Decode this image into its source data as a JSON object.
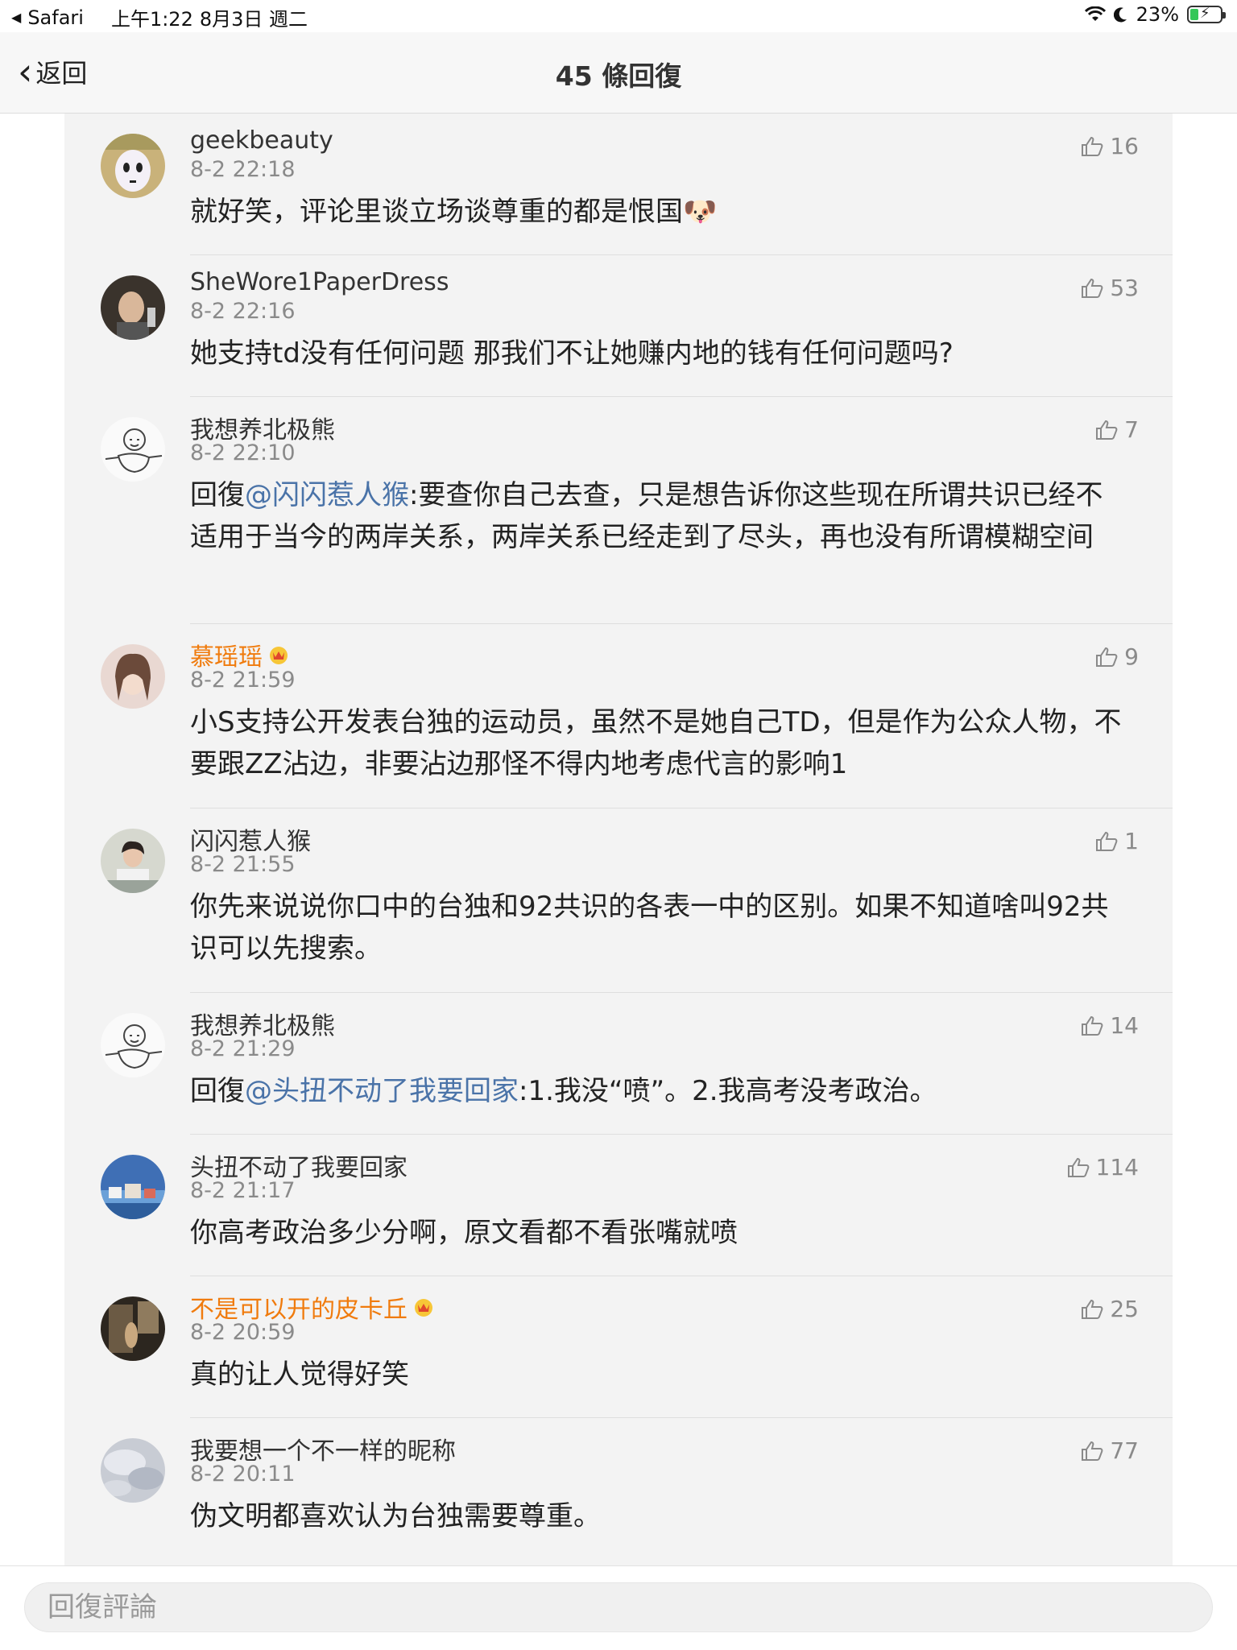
{
  "status_bar": {
    "back_app": "Safari",
    "time": "上午1:22",
    "date": "8月3日 週二",
    "battery": "23%"
  },
  "nav": {
    "back_label": "返回",
    "title": "45 條回復"
  },
  "comments": [
    {
      "name": "geekbeauty",
      "vip": false,
      "time": "8-2 22:18",
      "likes": "16",
      "text": "就好笑，评论里谈立场谈尊重的都是恨国🐶"
    },
    {
      "name": "SheWore1PaperDress",
      "vip": false,
      "time": "8-2 22:16",
      "likes": "53",
      "text": "她支持td没有任何问题 那我们不让她赚内地的钱有任何问题吗?"
    },
    {
      "name": "我想养北极熊",
      "vip": false,
      "time": "8-2 22:10",
      "likes": "7",
      "reply_prefix": "回復",
      "mention": "@闪闪惹人猴",
      "text": ":要查你自己去查，只是想告诉你这些现在所谓共识已经不适用于当今的两岸关系，两岸关系已经走到了尽头，再也没有所谓模糊空间"
    },
    {
      "name": "慕瑶瑶",
      "vip": true,
      "time": "8-2 21:59",
      "likes": "9",
      "text": "小S支持公开发表台独的运动员，虽然不是她自己TD，但是作为公众人物，不要跟ZZ沾边，非要沾边那怪不得内地考虑代言的影响1"
    },
    {
      "name": "闪闪惹人猴",
      "vip": false,
      "time": "8-2 21:55",
      "likes": "1",
      "text": "你先来说说你口中的台独和92共识的各表一中的区别。如果不知道啥叫92共识可以先搜索。"
    },
    {
      "name": "我想养北极熊",
      "vip": false,
      "time": "8-2 21:29",
      "likes": "14",
      "reply_prefix": "回復",
      "mention": "@头扭不动了我要回家",
      "text": ":1.我没“喷”。2.我高考没考政治。"
    },
    {
      "name": "头扭不动了我要回家",
      "vip": false,
      "time": "8-2 21:17",
      "likes": "114",
      "text": "你高考政治多少分啊，原文看都不看张嘴就喷"
    },
    {
      "name": "不是可以开的皮卡丘",
      "vip": true,
      "time": "8-2 20:59",
      "likes": "25",
      "text": "真的让人觉得好笑"
    },
    {
      "name": "我要想一个不一样的昵称",
      "vip": false,
      "time": "8-2 20:11",
      "likes": "77",
      "text": "伪文明都喜欢认为台独需要尊重。"
    }
  ],
  "reply_bar": {
    "placeholder": "回復評論"
  },
  "colors": {
    "vip_name": "#f07b0d",
    "mention": "#4a73a8",
    "battery_fill": "#34c759"
  }
}
